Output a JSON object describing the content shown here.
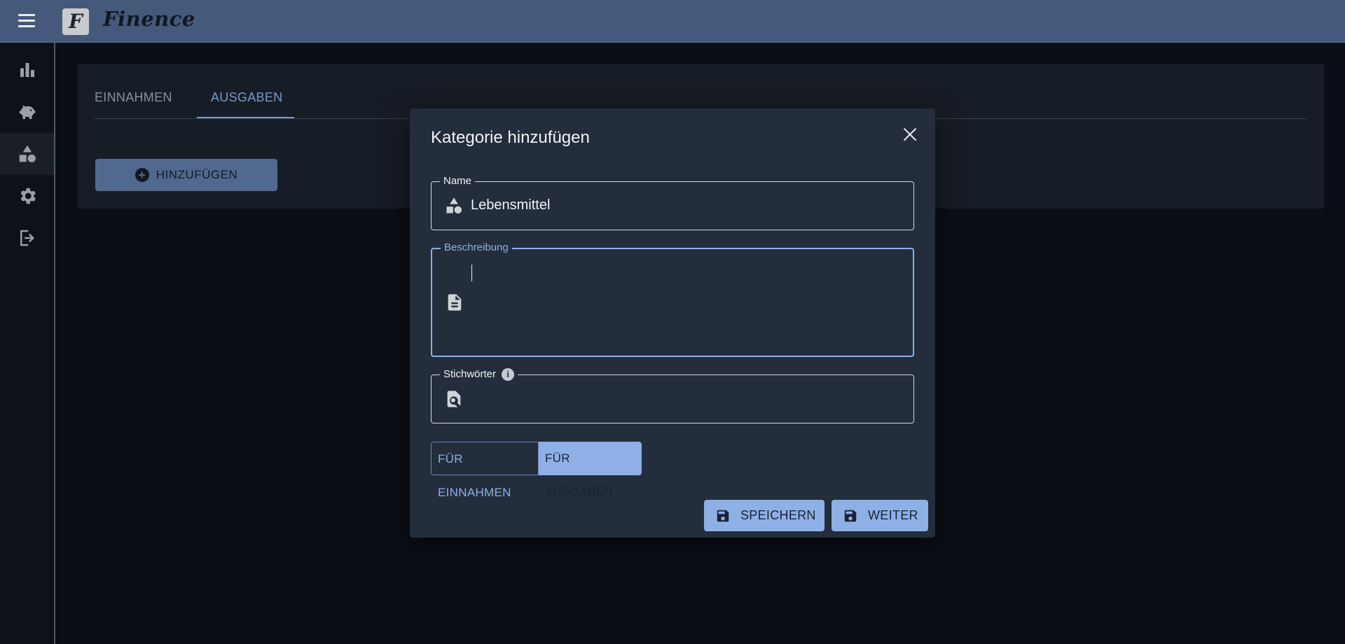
{
  "app": {
    "brand": "Finence",
    "logo_letter": "F"
  },
  "sidebar": {
    "items": [
      {
        "icon": "bar-chart-icon",
        "name": "statistics"
      },
      {
        "icon": "piggy-bank-icon",
        "name": "savings"
      },
      {
        "icon": "categories-icon",
        "name": "categories",
        "active": true
      },
      {
        "icon": "gear-icon",
        "name": "settings"
      },
      {
        "icon": "logout-icon",
        "name": "logout"
      }
    ]
  },
  "main": {
    "tabs": [
      {
        "label": "EINNAHMEN",
        "active": false
      },
      {
        "label": "AUSGABEN",
        "active": true
      }
    ],
    "add_button": {
      "label": "HINZUFÜGEN",
      "icon": "plus-circle-icon"
    }
  },
  "dialog": {
    "title": "Kategorie hinzufügen",
    "fields": {
      "name": {
        "label": "Name",
        "value": "Lebensmittel",
        "icon": "categories-icon"
      },
      "description": {
        "label": "Beschreibung",
        "value": "",
        "icon": "document-icon",
        "focused": true
      },
      "tags": {
        "label": "Stichwörter",
        "value": "",
        "icon": "file-search-icon",
        "info_icon": "info-icon"
      }
    },
    "type_toggle": {
      "options": [
        {
          "label": "FÜR EINNAHMEN",
          "selected": false
        },
        {
          "label": "FÜR AUSGABEN",
          "selected": true
        }
      ]
    },
    "buttons": {
      "save": {
        "label": "SPEICHERN",
        "icon": "floppy-disk-icon"
      },
      "next": {
        "label": "WEITER",
        "icon": "floppy-disk-icon"
      }
    }
  },
  "colors": {
    "topbar": "#45597a",
    "background": "#0b0f15",
    "panel": "#171d26",
    "dialog": "#232d3b",
    "accent": "#8fb0e6",
    "tab_active": "#7a98cc"
  }
}
